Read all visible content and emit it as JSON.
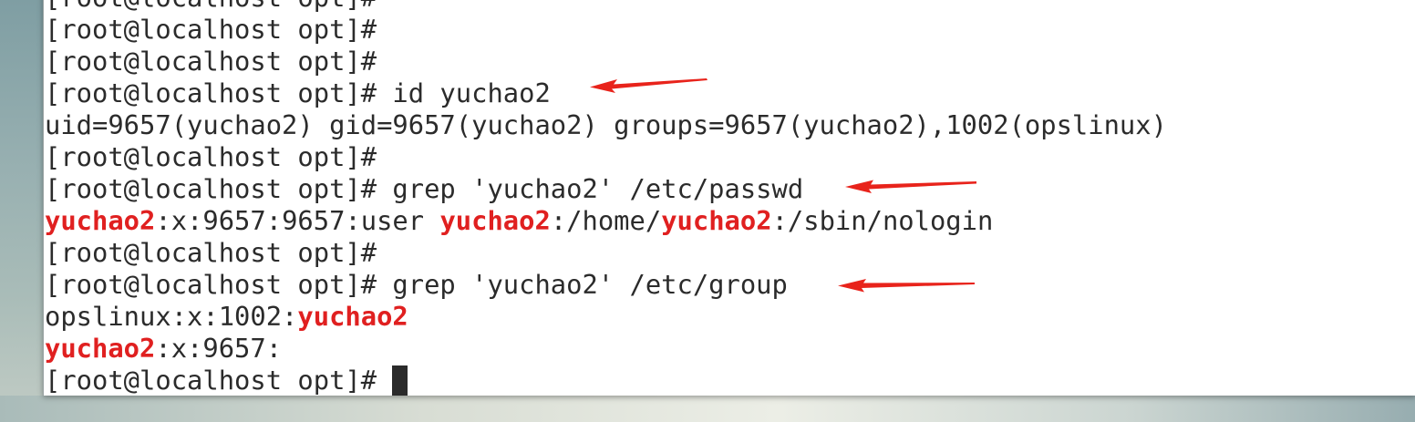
{
  "terminal": {
    "lines": [
      [
        {
          "t": "[root@localhost opt]#",
          "hl": false
        }
      ],
      [
        {
          "t": "[root@localhost opt]#",
          "hl": false
        }
      ],
      [
        {
          "t": "[root@localhost opt]#",
          "hl": false
        }
      ],
      [
        {
          "t": "[root@localhost opt]# id yuchao2",
          "hl": false
        }
      ],
      [
        {
          "t": "uid=9657(yuchao2) gid=9657(yuchao2) groups=9657(yuchao2),1002(opslinux)",
          "hl": false
        }
      ],
      [
        {
          "t": "[root@localhost opt]#",
          "hl": false
        }
      ],
      [
        {
          "t": "[root@localhost opt]# grep 'yuchao2' /etc/passwd",
          "hl": false
        }
      ],
      [
        {
          "t": "yuchao2",
          "hl": true
        },
        {
          "t": ":x:9657:9657:user ",
          "hl": false
        },
        {
          "t": "yuchao2",
          "hl": true
        },
        {
          "t": ":/home/",
          "hl": false
        },
        {
          "t": "yuchao2",
          "hl": true
        },
        {
          "t": ":/sbin/nologin",
          "hl": false
        }
      ],
      [
        {
          "t": "[root@localhost opt]#",
          "hl": false
        }
      ],
      [
        {
          "t": "[root@localhost opt]# grep 'yuchao2' /etc/group",
          "hl": false
        }
      ],
      [
        {
          "t": "opslinux:x:1002:",
          "hl": false
        },
        {
          "t": "yuchao2",
          "hl": true
        }
      ],
      [
        {
          "t": "yuchao2",
          "hl": true
        },
        {
          "t": ":x:9657:",
          "hl": false
        }
      ],
      [
        {
          "t": "[root@localhost opt]# ",
          "hl": false
        }
      ]
    ],
    "cursor_line": 12
  },
  "colors": {
    "text": "#2b2b2b",
    "highlight": "#e02020",
    "arrow": "#e8231b",
    "background": "#ffffff"
  },
  "annotations": {
    "arrow_count": 3
  }
}
